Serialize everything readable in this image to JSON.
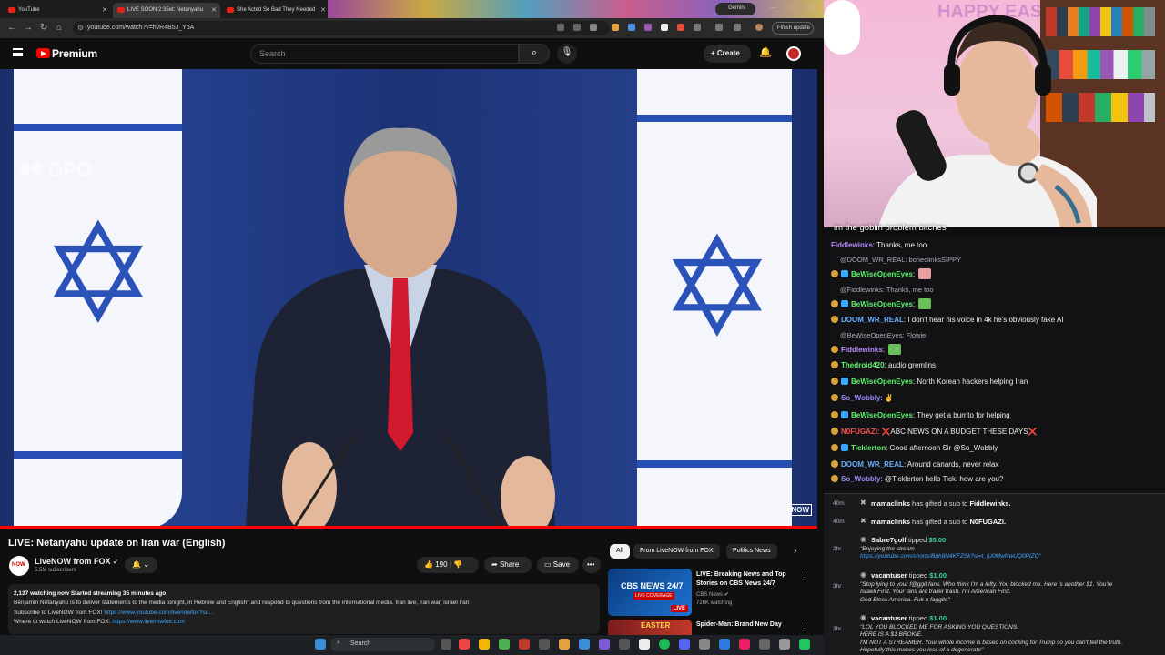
{
  "browser": {
    "tabs": [
      {
        "label": "YouTube"
      },
      {
        "label": "LIVE SOON 2:35et: Netanyahu"
      },
      {
        "label": "She Acted So Bad They Needed"
      }
    ],
    "gemini_label": "Gemini",
    "url": "youtube.com/watch?v=hvR4B5J_YbA",
    "finish_update": "Finish update"
  },
  "youtube": {
    "brand": "Premium",
    "search_placeholder": "Search",
    "create_label": "Create",
    "video": {
      "watermark": "GPO",
      "corner_mark": "NOW",
      "progress": 1.0
    },
    "title": "LIVE: Netanyahu update on Iran war (English)",
    "channel": {
      "name": "LiveNOW from FOX",
      "subscribers": "5.5M subscribers"
    },
    "actions": {
      "likes": "190",
      "share": "Share",
      "save": "Save"
    },
    "description": {
      "stats": "2,137 watching now  Started streaming 35 minutes ago",
      "line1": "Benjamin Netanyahu is to deliver statements to the media tonight, in Hebrew and English* and respond to questions from the international media. Iran live, iran war, israel iran",
      "line2_prefix": "Subscribe to LiveNOW from FOX! ",
      "line2_link": "https://www.youtube.com/livenowfox?su...",
      "line3_prefix": "Where to watch LiveNOW from FOX: ",
      "line3_link": "https://www.livenowfox.com"
    },
    "chips": [
      "All",
      "From LiveNOW from FOX",
      "Politics News"
    ],
    "related": [
      {
        "title": "LIVE: Breaking News and Top Stories on CBS News 24/7",
        "channel": "CBS News",
        "meta": "726K watching",
        "badge": "LIVE",
        "thumb_text": "CBS NEWS 24/7",
        "thumb_sub": "LIVE COVERAGE"
      },
      {
        "title": "Spider-Man: Brand New Day",
        "thumb_text": "EASTER"
      }
    ]
  },
  "taskbar": {
    "search_label": "Search"
  },
  "stream": {
    "caption": "im the goblin problem bitches",
    "banner": "HAPPY EASTER"
  },
  "chat": [
    {
      "type": "msg",
      "user": "Fiddlewinks",
      "color": "#b98cff",
      "text": "Thanks, me too"
    },
    {
      "type": "reply",
      "text": "@DOOM_WR_REAL: boneclinksSIPPY"
    },
    {
      "type": "msg",
      "user": "BeWiseOpenEyes",
      "color": "#5ff26e",
      "text": ""
    },
    {
      "type": "reply",
      "text": "@Fiddlewinks: Thanks, me too"
    },
    {
      "type": "msg",
      "user": "BeWiseOpenEyes",
      "color": "#5ff26e",
      "text": ""
    },
    {
      "type": "msg",
      "user": "DOOM_WR_REAL",
      "color": "#6ab0ff",
      "text": "I don't hear his voice in 4k he's obviously fake AI"
    },
    {
      "type": "reply",
      "text": "@BeWiseOpenEyes: Flowie"
    },
    {
      "type": "msg",
      "user": "Fiddlewinks",
      "color": "#b98cff",
      "text": ""
    },
    {
      "type": "msg",
      "user": "Thedroid420",
      "color": "#5ff26e",
      "text": "audio gremlins"
    },
    {
      "type": "msg",
      "user": "BeWiseOpenEyes",
      "color": "#5ff26e",
      "text": "North Korean hackers helping Iran"
    },
    {
      "type": "msg",
      "user": "So_Wobbly",
      "color": "#9b8cff",
      "text": "✌"
    },
    {
      "type": "msg",
      "user": "BeWiseOpenEyes",
      "color": "#5ff26e",
      "text": "They get a burrito for helping"
    },
    {
      "type": "msg",
      "user": "N0FUGAZI",
      "color": "#ff4d4d",
      "text": "❌ABC NEWS ON A BUDGET THESE DAYS❌"
    },
    {
      "type": "msg",
      "user": "Ticklerton",
      "color": "#5ff26e",
      "text": "Good afternoon Sir @So_Wobbly"
    },
    {
      "type": "msg",
      "user": "DOOM_WR_REAL",
      "color": "#6ab0ff",
      "text": "Around canards, never relax"
    },
    {
      "type": "msg",
      "user": "So_Wobbly",
      "color": "#9b8cff",
      "text": "@Ticklerton hello Tick. how are you?"
    }
  ],
  "events": [
    {
      "time": "40m",
      "user": "mamaclinks",
      "action": "has gifted a sub to",
      "target": "Fiddlewinks."
    },
    {
      "time": "40m",
      "user": "mamaclinks",
      "action": "has gifted a sub to",
      "target": "N0FUGAZI."
    },
    {
      "time": "2hr",
      "user": "Sabre7golf",
      "action": "tipped",
      "amount": "$5.00",
      "note": "\"Enjoying the stream",
      "link": "https://youtube.com/shorts/Bgh8N4KFZSk?si=t_iU0MwNwUQ0PIZQ\""
    },
    {
      "time": "3hr",
      "user": "vacantuser",
      "action": "tipped",
      "amount": "$1.00",
      "note": "\"Stop lying to your f@ggit fans. Who think I'm a lefty. You blocked me. Here is another $1. You're\nIsraeli First. Your fans are trailer trash. I'm American First.\nGod Bless America. Fuk u faggits\""
    },
    {
      "time": "3hr",
      "user": "vacantuser",
      "action": "tipped",
      "amount": "$1.00",
      "note": "\"LOL YOU BLOCKED ME FOR ASKING YOU QUESTIONS.\nHERE IS A $1 BROKIE.\nI'M NOT A STREAMER. Your whole income is based on cocking for Trump so you can't tell the truth.\nHopefully this makes you less of a degenerate\""
    }
  ]
}
